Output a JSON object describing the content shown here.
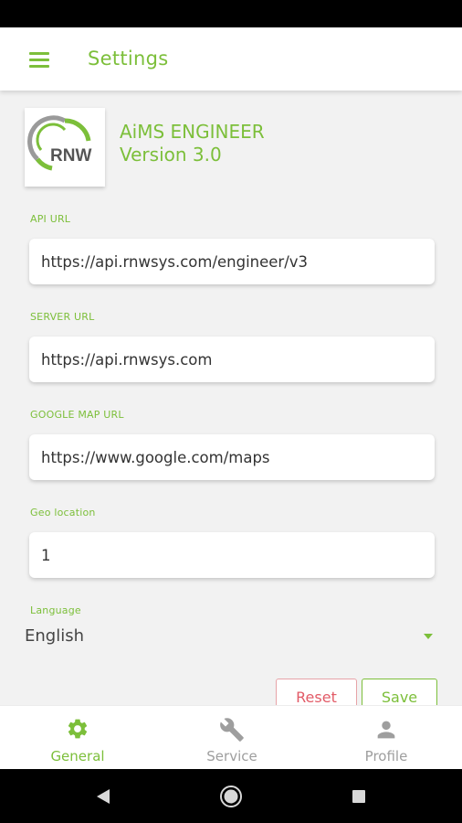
{
  "app_bar": {
    "title": "Settings"
  },
  "header": {
    "logo_text": "RNW",
    "app_name": "AiMS ENGINEER",
    "version": "Version 3.0"
  },
  "fields": {
    "api_url": {
      "label": "API URL",
      "value": "https://api.rnwsys.com/engineer/v3"
    },
    "server_url": {
      "label": "SERVER URL",
      "value": "https://api.rnwsys.com"
    },
    "google_map_url": {
      "label": "GOOGLE MAP URL",
      "value": "https://www.google.com/maps"
    },
    "geo_location": {
      "label": "Geo location",
      "value": "1"
    }
  },
  "language": {
    "label": "Language",
    "value": "English"
  },
  "buttons": {
    "reset": "Reset",
    "save": "Save"
  },
  "bottom_nav": {
    "general": "General",
    "service": "Service",
    "profile": "Profile",
    "active": "general"
  },
  "colors": {
    "accent": "#7cbf3a",
    "reset": "#e25b67",
    "inactive": "#9e9e9e"
  },
  "icons": {
    "menu": "menu-icon",
    "general": "gear-icon",
    "service": "wrench-icon",
    "profile": "person-icon",
    "back": "back-triangle-icon",
    "home": "home-circle-icon",
    "recents": "recents-square-icon"
  }
}
